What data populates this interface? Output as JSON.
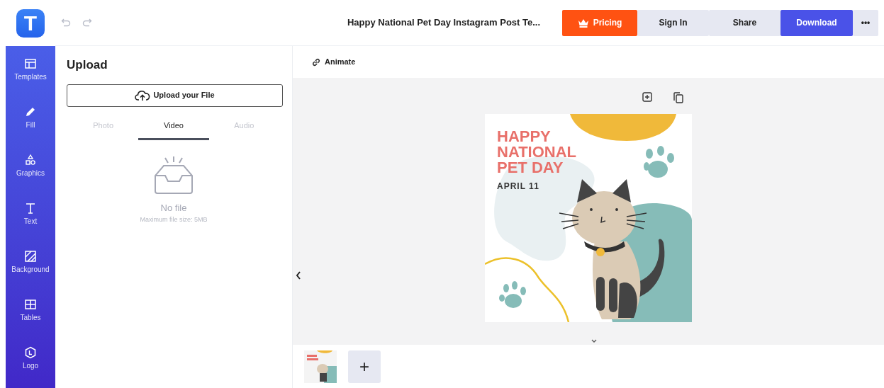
{
  "app": {
    "logo": "T"
  },
  "header": {
    "title": "Happy National Pet Day Instagram Post Te...",
    "buttons": [
      {
        "label": "Pricing",
        "kind": "pricing"
      },
      {
        "label": "Sign In",
        "kind": "plain"
      },
      {
        "label": "Share",
        "kind": "plain"
      },
      {
        "label": "Download",
        "kind": "primary"
      },
      {
        "label": "•••",
        "kind": "more"
      }
    ]
  },
  "sidebar": {
    "items": [
      {
        "label": "Templates"
      },
      {
        "label": "Fill"
      },
      {
        "label": "Graphics"
      },
      {
        "label": "Text"
      },
      {
        "label": "Background"
      },
      {
        "label": "Tables"
      },
      {
        "label": "Logo"
      }
    ]
  },
  "panel": {
    "title": "Upload",
    "upload_button": "Upload your File",
    "tabs": [
      {
        "label": "Photo",
        "selected": false
      },
      {
        "label": "Video",
        "selected": true
      },
      {
        "label": "Audio",
        "selected": false
      }
    ],
    "empty": {
      "title": "No file",
      "hint": "Maximum file size: 5MB"
    }
  },
  "canvas": {
    "animate": "Animate",
    "design": {
      "headline": [
        "HAPPY",
        "NATIONAL",
        "PET DAY"
      ],
      "date": "APRIL 11"
    }
  },
  "pages": {
    "add": "+"
  }
}
